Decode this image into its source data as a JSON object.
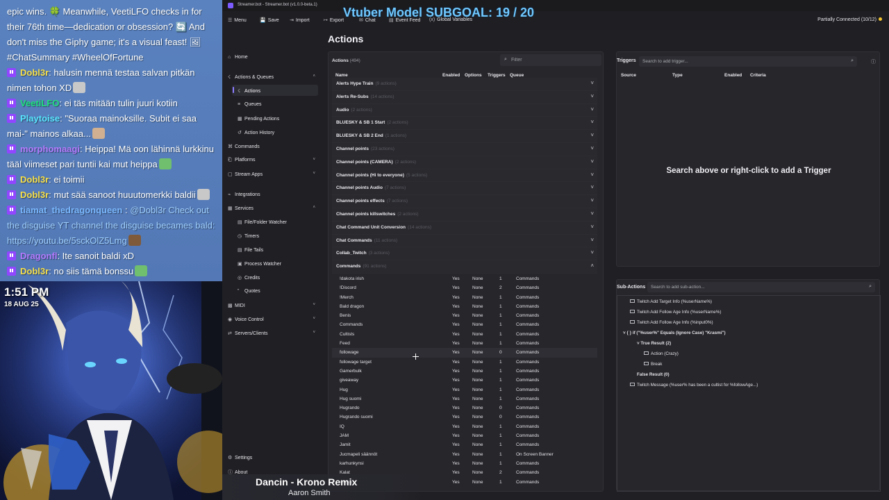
{
  "overlay": {
    "chat": [
      {
        "user": "",
        "user_class": "",
        "text": "epic wins. 🍀 Meanwhile, VeetiLFO checks in for their 76th time—dedication or obsession? 🔄 And don't miss the Giphy game; it's a visual feast! 🖼 #ChatSummary #WheelOfFortune",
        "icon": false
      },
      {
        "user": "Dobl3r",
        "user_class": "u-yellow",
        "text": ": halusin mennä testaa salvan pitkän nimen tohon XD",
        "icon": true
      },
      {
        "user": "VeetiLFO",
        "user_class": "u-green",
        "text": ": ei täs mitään tulin juuri kotiin",
        "icon": true
      },
      {
        "user": "Playtoise",
        "user_class": "u-cyan",
        "text": ": \"Suoraa mainoksille. Subit ei saa mai-\" mainos alkaa...",
        "icon": true
      },
      {
        "user": "morphomaagi",
        "user_class": "u-purple",
        "text": ": Heippa! Mä oon lähinnä lurkkinu tääl viimeset pari tuntii kai",
        "tail": " mut heippa",
        "icon": true
      },
      {
        "user": "Dobl3r",
        "user_class": "u-yellow",
        "text": ": ei toimii",
        "icon": true
      },
      {
        "user": "Dobl3r",
        "user_class": "u-yellow",
        "text": ": mut sää sanoot huuutomerkki baldii",
        "icon": true
      },
      {
        "user": "tiamat_thedragonqueen",
        "user_class": "u-blue",
        "text": " : ",
        "mention": "@Dobl3r Check out the disguise YT channel",
        "tail": " the disguise becames bald: https://youtu.be/5sckOlZ5Lmg",
        "icon": true
      },
      {
        "user": "Dragonfl",
        "user_class": "u-purple",
        "text": ": Ite sanoit baldi xD",
        "icon": true
      },
      {
        "user": "Dobl3r",
        "user_class": "u-yellow",
        "text": ": no siis tämä bonssu",
        "icon": true
      }
    ],
    "clock": "1:51 PM",
    "date": "18 AUG 25",
    "subgoal": "Vtuber Model SUBGOAL: 19 / 20",
    "now_playing": {
      "song": "Dancin - Krono Remix",
      "artist": "Aaron Smith"
    }
  },
  "window": {
    "title": "Streamer.bot - Streamer.bot (v1.0.0-beta.1)",
    "menu": [
      {
        "icon": "☰",
        "label": "Menu",
        "name": "menu"
      },
      {
        "icon": "💾",
        "label": "Save",
        "name": "save"
      },
      {
        "icon": "⇥",
        "label": "Import",
        "name": "import"
      },
      {
        "icon": "↦",
        "label": "Export",
        "name": "export"
      },
      {
        "icon": "✉",
        "label": "Chat",
        "name": "chat"
      },
      {
        "icon": "▤",
        "label": "Event Feed",
        "name": "event-feed"
      },
      {
        "icon": "(x)",
        "label": "Global Variables",
        "name": "global-variables"
      }
    ],
    "connection": "Partially Connected (10/12)",
    "connection_color": "#f4c430"
  },
  "sidebar": {
    "items": [
      {
        "label": "Home",
        "icon": "⌂",
        "sub": false,
        "chev": ""
      },
      {
        "label": "Actions & Queues",
        "icon": "☇",
        "sub": false,
        "chev": "˄"
      },
      {
        "label": "Actions",
        "icon": "☇",
        "sub": true,
        "chev": "",
        "active": true
      },
      {
        "label": "Queues",
        "icon": "≡",
        "sub": true,
        "chev": ""
      },
      {
        "label": "Pending Actions",
        "icon": "▦",
        "sub": true,
        "chev": ""
      },
      {
        "label": "Action History",
        "icon": "↺",
        "sub": true,
        "chev": ""
      },
      {
        "label": "Commands",
        "icon": "⌘",
        "sub": false,
        "chev": ""
      },
      {
        "label": "Platforms",
        "icon": "⎗",
        "sub": false,
        "chev": "˅"
      },
      {
        "label": "Stream Apps",
        "icon": "▢",
        "sub": false,
        "chev": "˅"
      },
      {
        "label": "Integrations",
        "icon": "⌁",
        "sub": false,
        "chev": ""
      },
      {
        "label": "Services",
        "icon": "▦",
        "sub": false,
        "chev": "˄"
      },
      {
        "label": "File/Folder Watcher",
        "icon": "▤",
        "sub": true,
        "chev": ""
      },
      {
        "label": "Timers",
        "icon": "◷",
        "sub": true,
        "chev": ""
      },
      {
        "label": "File Tails",
        "icon": "▤",
        "sub": true,
        "chev": ""
      },
      {
        "label": "Process Watcher",
        "icon": "▣",
        "sub": true,
        "chev": ""
      },
      {
        "label": "Credits",
        "icon": "◎",
        "sub": true,
        "chev": ""
      },
      {
        "label": "Quotes",
        "icon": "”",
        "sub": true,
        "chev": ""
      },
      {
        "label": "MIDI",
        "icon": "▩",
        "sub": false,
        "chev": "˅"
      },
      {
        "label": "Voice Control",
        "icon": "◉",
        "sub": false,
        "chev": "˅"
      },
      {
        "label": "Servers/Clients",
        "icon": "⇄",
        "sub": false,
        "chev": "˅"
      }
    ],
    "settings": "Settings",
    "about": "About"
  },
  "actions": {
    "title": "Actions",
    "count_label": "Actions",
    "count": "(494)",
    "filter_placeholder": "Filter",
    "columns": [
      "Name",
      "Enabled",
      "Options",
      "Triggers",
      "Queue"
    ],
    "groups": [
      {
        "name": "Alerts Hype Train",
        "count": "(9 actions)"
      },
      {
        "name": "Alerts Re-Subs",
        "count": "(14 actions)"
      },
      {
        "name": "Audio",
        "count": "(2 actions)"
      },
      {
        "name": "BLUESKY & SB 1 Start",
        "count": "(2 actions)"
      },
      {
        "name": "BLUESKY & SB 2 End",
        "count": "(1 actions)"
      },
      {
        "name": "Channel points",
        "count": "(23 actions)"
      },
      {
        "name": "Channel points (CAMERA)",
        "count": "(2 actions)"
      },
      {
        "name": "Channel points (Hi to everyone)",
        "count": "(5 actions)"
      },
      {
        "name": "Channel points Audio",
        "count": "(7 actions)"
      },
      {
        "name": "Channel points effects",
        "count": "(7 actions)"
      },
      {
        "name": "Channel points killswitches",
        "count": "(2 actions)"
      },
      {
        "name": "Chat Command Unit Conversion",
        "count": "(14 actions)"
      },
      {
        "name": "Chat Commands",
        "count": "(11 actions)"
      },
      {
        "name": "Collab_Twitch",
        "count": "(3 actions)"
      },
      {
        "name": "Commands",
        "count": "(91 actions)",
        "open": true
      }
    ],
    "rows": [
      {
        "name": "!dakota irish",
        "enabled": "Yes",
        "options": "None",
        "triggers": "1",
        "queue": "Commands"
      },
      {
        "name": "!Discord",
        "enabled": "Yes",
        "options": "None",
        "triggers": "2",
        "queue": "Commands"
      },
      {
        "name": "!Merch",
        "enabled": "Yes",
        "options": "None",
        "triggers": "1",
        "queue": "Commands"
      },
      {
        "name": "Bald dragon",
        "enabled": "Yes",
        "options": "None",
        "triggers": "1",
        "queue": "Commands"
      },
      {
        "name": "Benis",
        "enabled": "Yes",
        "options": "None",
        "triggers": "1",
        "queue": "Commands"
      },
      {
        "name": "Commands",
        "enabled": "Yes",
        "options": "None",
        "triggers": "1",
        "queue": "Commands"
      },
      {
        "name": "Cultists",
        "enabled": "Yes",
        "options": "None",
        "triggers": "1",
        "queue": "Commands"
      },
      {
        "name": "Feed",
        "enabled": "Yes",
        "options": "None",
        "triggers": "1",
        "queue": "Commands"
      },
      {
        "name": "followage",
        "enabled": "Yes",
        "options": "None",
        "triggers": "0",
        "queue": "Commands",
        "hl": true
      },
      {
        "name": "followage target",
        "enabled": "Yes",
        "options": "None",
        "triggers": "1",
        "queue": "Commands"
      },
      {
        "name": "Gamerbulk",
        "enabled": "Yes",
        "options": "None",
        "triggers": "1",
        "queue": "Commands"
      },
      {
        "name": "giveaway",
        "enabled": "Yes",
        "options": "None",
        "triggers": "1",
        "queue": "Commands"
      },
      {
        "name": "Hug",
        "enabled": "Yes",
        "options": "None",
        "triggers": "1",
        "queue": "Commands"
      },
      {
        "name": "Hug suomi",
        "enabled": "Yes",
        "options": "None",
        "triggers": "1",
        "queue": "Commands"
      },
      {
        "name": "Hugrando",
        "enabled": "Yes",
        "options": "None",
        "triggers": "0",
        "queue": "Commands"
      },
      {
        "name": "Hugrando suomi",
        "enabled": "Yes",
        "options": "None",
        "triggers": "0",
        "queue": "Commands"
      },
      {
        "name": "IQ",
        "enabled": "Yes",
        "options": "None",
        "triggers": "1",
        "queue": "Commands"
      },
      {
        "name": "JAM",
        "enabled": "Yes",
        "options": "None",
        "triggers": "1",
        "queue": "Commands"
      },
      {
        "name": "Jamit",
        "enabled": "Yes",
        "options": "None",
        "triggers": "1",
        "queue": "Commands"
      },
      {
        "name": "Jucmapeli säännöt",
        "enabled": "Yes",
        "options": "None",
        "triggers": "1",
        "queue": "On Screen Banner"
      },
      {
        "name": "karhunkynsi",
        "enabled": "Yes",
        "options": "None",
        "triggers": "1",
        "queue": "Commands"
      },
      {
        "name": "Kalat",
        "enabled": "Yes",
        "options": "None",
        "triggers": "2",
        "queue": "Commands"
      },
      {
        "name": "Kaljaa",
        "enabled": "Yes",
        "options": "None",
        "triggers": "1",
        "queue": "Commands"
      }
    ]
  },
  "triggers": {
    "title": "Triggers",
    "search_placeholder": "Search to add trigger...",
    "columns": [
      "Source",
      "Type",
      "Enabled",
      "Criteria"
    ],
    "empty": "Search above or right-click to add a Trigger"
  },
  "subactions": {
    "title": "Sub-Actions",
    "search_placeholder": "Search to add sub-action...",
    "items": [
      {
        "text": "Twitch Add Target Info (%userName%)",
        "indent": 0,
        "box": true,
        "bold": false
      },
      {
        "text": "Twitch Add Follow Age Info (%userName%)",
        "indent": 0,
        "box": true,
        "bold": false
      },
      {
        "text": "Twitch Add Follow Age Info (%input0%)",
        "indent": 0,
        "box": true,
        "bold": false
      },
      {
        "text": "˅ { } if (\"%user%\" Equals (Ignore Case) \"Krasmi\")",
        "indent": -1,
        "box": false,
        "bold": true
      },
      {
        "text": "˅ True Result (2)",
        "indent": 1,
        "box": false,
        "bold": true
      },
      {
        "text": "Action (Crazy)",
        "indent": 2,
        "box": true,
        "bold": false
      },
      {
        "text": "Break",
        "indent": 2,
        "box": true,
        "bold": false
      },
      {
        "text": "False Result (0)",
        "indent": 1,
        "box": false,
        "bold": true
      },
      {
        "text": "Twitch Message (%user% has been a cultist for %followAge...)",
        "indent": 0,
        "box": true,
        "bold": false
      }
    ]
  }
}
